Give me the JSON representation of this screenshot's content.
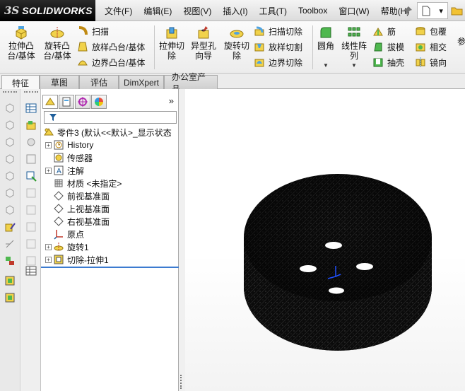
{
  "app": {
    "logo_prefix": "3S",
    "logo_text": "SOLIDWORKS"
  },
  "menu": [
    "文件(F)",
    "编辑(E)",
    "视图(V)",
    "插入(I)",
    "工具(T)",
    "Toolbox",
    "窗口(W)",
    "帮助(H)"
  ],
  "toolbar": {
    "extrude_boss": "拉伸凸\n台/基体",
    "revolve_boss": "旋转凸\n台/基体",
    "sweep": "扫描",
    "loft": "放样凸台/基体",
    "boundary_boss": "边界凸台/基体",
    "extrude_cut": "拉伸切\n除",
    "hole_wizard": "异型孔\n向导",
    "revolve_cut": "旋转切\n除",
    "swept_cut": "扫描切除",
    "lofted_cut": "放样切割",
    "boundary_cut": "边界切除",
    "fillet": "圆角",
    "linear_pattern": "线性阵\n列",
    "rib": "筋",
    "draft": "拔模",
    "shell": "抽壳",
    "wrap": "包覆",
    "intersect": "相交",
    "mirror": "镜向",
    "ref_geometry_partial": "参"
  },
  "tabs": [
    "特征",
    "草图",
    "评估",
    "DimXpert",
    "办公室产品"
  ],
  "active_tab": 0,
  "tree": {
    "root": "零件3  (默认<<默认>_显示状态",
    "items": [
      {
        "label": "History",
        "expand": true,
        "icon": "history-icon"
      },
      {
        "label": "传感器",
        "expand": false,
        "icon": "sensor-icon"
      },
      {
        "label": "注解",
        "expand": true,
        "icon": "annotation-icon"
      },
      {
        "label": "材质 <未指定>",
        "expand": false,
        "icon": "material-icon"
      },
      {
        "label": "前视基准面",
        "expand": false,
        "icon": "plane-icon"
      },
      {
        "label": "上视基准面",
        "expand": false,
        "icon": "plane-icon"
      },
      {
        "label": "右视基准面",
        "expand": false,
        "icon": "plane-icon"
      },
      {
        "label": "原点",
        "expand": false,
        "icon": "origin-icon"
      },
      {
        "label": "旋转1",
        "expand": true,
        "icon": "revolve-feature-icon"
      },
      {
        "label": "切除-拉伸1",
        "expand": true,
        "icon": "cut-extrude-feature-icon"
      }
    ]
  },
  "colors": {
    "accent_blue": "#3c7bd0",
    "model_black": "#0b0b0b",
    "logo_red": "#ff3b2f"
  }
}
